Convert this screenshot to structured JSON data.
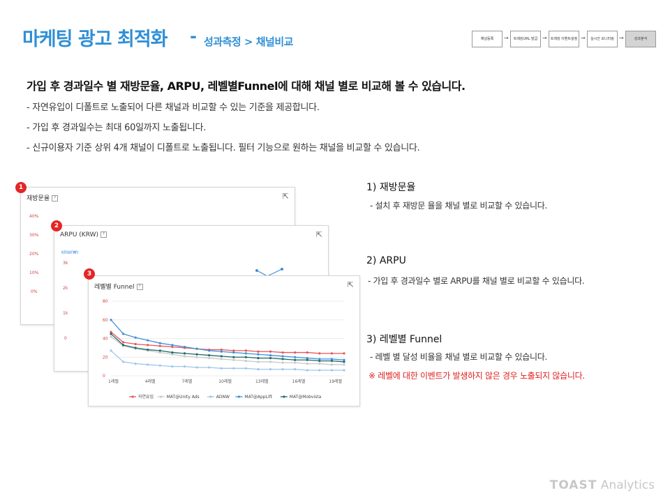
{
  "header": {
    "title": "마케팅 광고 최적화",
    "dash": "-",
    "subtitle": "성과측정 > 채널비교"
  },
  "flow": {
    "steps": [
      "채널등록",
      "트래킹URL 발급",
      "트래킹 이벤트설정",
      "실시간 모니터링",
      "성과분석"
    ],
    "active_index": 4
  },
  "intro": {
    "headline": "가입 후 경과일수 별 재방문율, ARPU, 레벨별Funnel에 대해 채널 별로 비교해 볼 수 있습니다.",
    "bullets": [
      "- 자연유입이 디폴트로 노출되어 다른 채널과 비교할 수 있는 기준을 제공합니다.",
      "- 가입 후 경과일수는 최대 60일까지 노출됩니다.",
      "- 신규이용자 기준 상위 4개 채널이 디폴트로 노출됩니다. 필터 기능으로 원하는 채널을 비교할 수 있습니다."
    ]
  },
  "cards": {
    "c1": {
      "badge": "1",
      "title": "재방문율",
      "ylabels": [
        "40%",
        "30%",
        "20%",
        "10%",
        "0%"
      ]
    },
    "c2": {
      "badge": "2",
      "title": "ARPU (KRW)",
      "unit": "KRW(₩)",
      "ylabels": [
        "3k",
        "2k",
        "1k",
        "0"
      ]
    },
    "c3": {
      "badge": "3",
      "title": "레벨별 Funnel"
    }
  },
  "chart_data": {
    "type": "line",
    "title": "레벨별 Funnel",
    "x": [
      "1레벨",
      "2레벨",
      "3레벨",
      "4레벨",
      "5레벨",
      "6레벨",
      "7레벨",
      "8레벨",
      "9레벨",
      "10레벨",
      "11레벨",
      "12레벨",
      "13레벨",
      "14레벨",
      "15레벨",
      "16레벨",
      "17레벨",
      "18레벨",
      "19레벨",
      "20레벨"
    ],
    "xticks": [
      "1레벨",
      "4레벨",
      "7레벨",
      "10레벨",
      "13레벨",
      "16레벨",
      "19레벨"
    ],
    "ylim": [
      0,
      80
    ],
    "yticks": [
      0,
      20,
      40,
      60,
      80
    ],
    "grid": true,
    "legend_position": "bottom",
    "series": [
      {
        "name": "자연유입",
        "color": "#e8545b",
        "values": [
          47,
          36,
          34,
          33,
          32,
          31,
          30,
          29,
          28,
          28,
          27,
          27,
          26,
          26,
          25,
          25,
          25,
          24,
          24,
          24
        ]
      },
      {
        "name": "MAT@Unity Ads",
        "color": "#c9c9c9",
        "values": [
          42,
          32,
          29,
          27,
          25,
          23,
          21,
          20,
          19,
          18,
          17,
          16,
          15,
          15,
          14,
          14,
          13,
          13,
          12,
          12
        ]
      },
      {
        "name": "ADNW",
        "color": "#9ec6ee",
        "values": [
          27,
          15,
          13,
          12,
          11,
          10,
          10,
          9,
          9,
          8,
          8,
          8,
          7,
          7,
          7,
          7,
          6,
          6,
          6,
          6
        ]
      },
      {
        "name": "MAT@AppLift",
        "color": "#3f8fd8",
        "values": [
          60,
          45,
          41,
          38,
          35,
          33,
          31,
          29,
          27,
          26,
          25,
          24,
          23,
          22,
          21,
          20,
          19,
          18,
          18,
          17
        ]
      },
      {
        "name": "MAT@Mobvista",
        "color": "#1f6b6b",
        "values": [
          45,
          33,
          30,
          28,
          27,
          25,
          24,
          23,
          22,
          21,
          20,
          20,
          19,
          19,
          18,
          17,
          17,
          16,
          16,
          15
        ]
      }
    ]
  },
  "sections": [
    {
      "title": "1) 재방문율",
      "desc": "- 설치 후 재방문 율을 채널 별로 비교할 수 있습니다."
    },
    {
      "title": "2) ARPU",
      "desc": "- 가입 후 경과일수 별로 ARPU를 채널 별로 비교할 수 있습니다."
    },
    {
      "title": "3) 레벨별 Funnel",
      "desc": "- 레벨 별 달성 비율을 채널 별로 비교할 수 있습니다.",
      "warn": "※ 레벨에 대한 이벤트가 발생하지 않은 경우 노출되지 않습니다."
    }
  ],
  "brand": {
    "bold": "TOAST",
    "light": "Analytics"
  }
}
